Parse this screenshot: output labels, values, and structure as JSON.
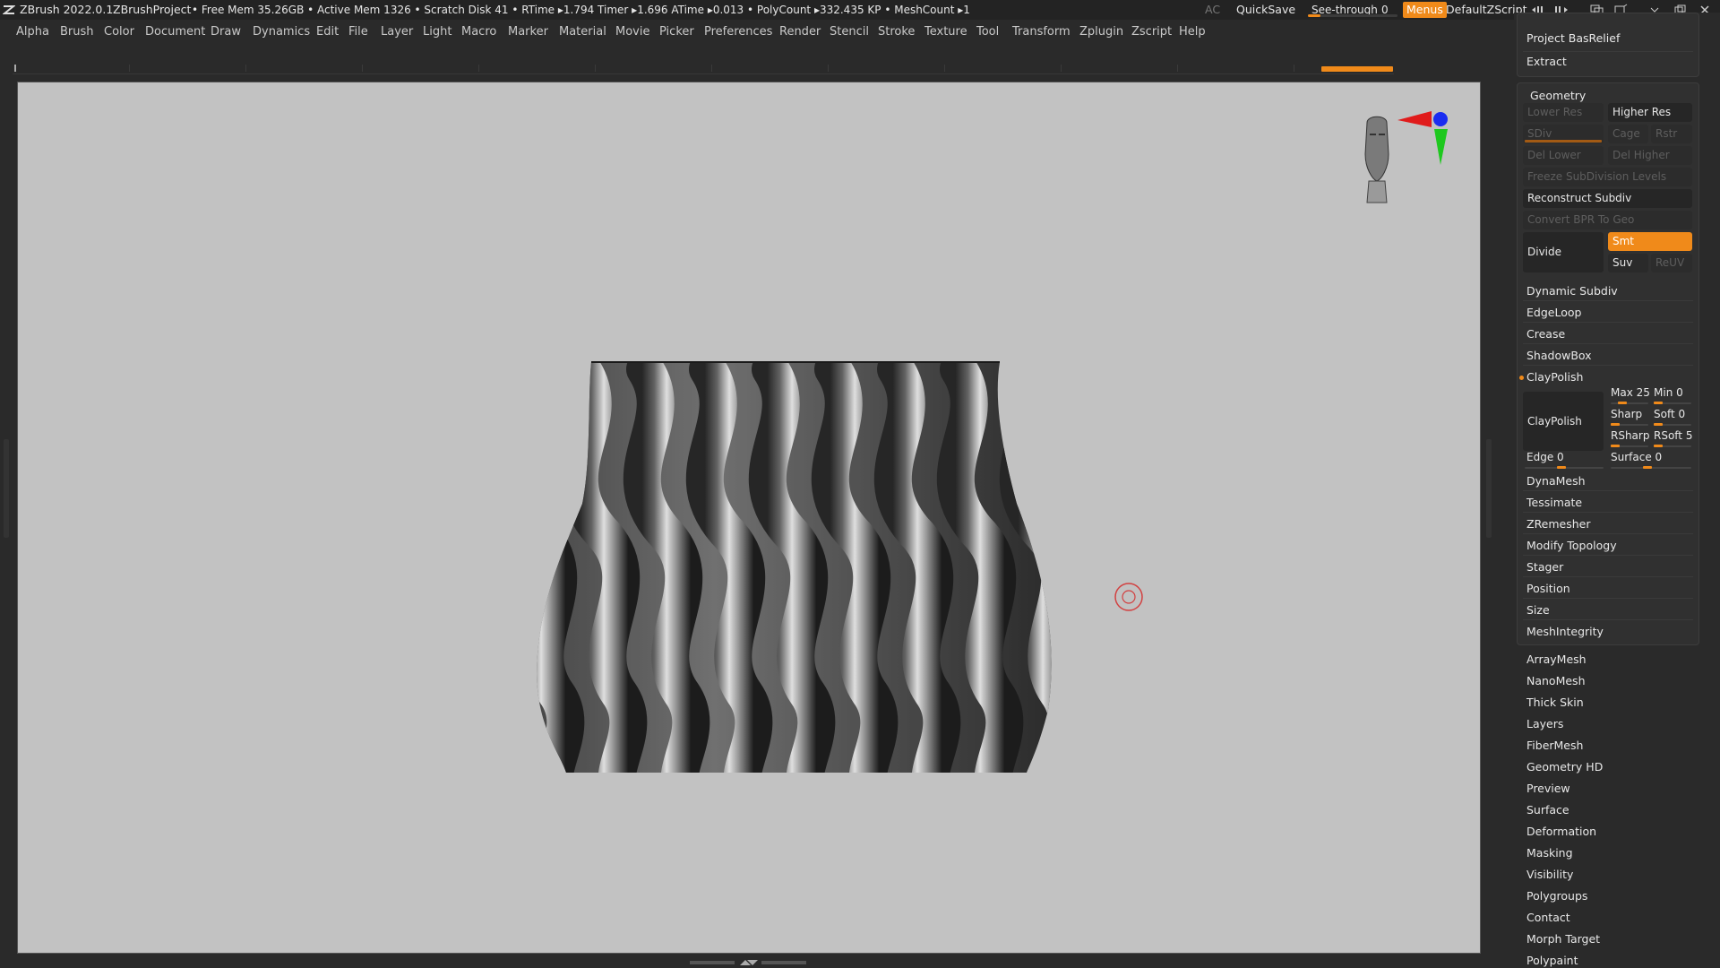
{
  "titlebar": {
    "app": "ZBrush 2022.0.1",
    "project": "ZBrushProject",
    "stats": "• Free Mem 35.26GB • Active Mem 1326 • Scratch Disk 41 •  RTime ▸1.794 Timer ▸1.696 ATime ▸0.013 • PolyCount ▸332.435 KP  • MeshCount ▸1",
    "ac": "AC",
    "quicksave": "QuickSave",
    "seethrough_label": "See-through",
    "seethrough_value": "0",
    "menus": "Menus",
    "script": "DefaultZScript"
  },
  "menubar": {
    "items": [
      "Alpha",
      "Brush",
      "Color",
      "Document",
      "Draw",
      "Dynamics",
      "Edit",
      "File",
      "Layer",
      "Light",
      "Macro",
      "Marker",
      "Material",
      "Movie",
      "Picker",
      "Preferences",
      "Render",
      "Stencil",
      "Stroke",
      "Texture",
      "Tool",
      "Transform",
      "Zplugin",
      "Zscript",
      "Help"
    ]
  },
  "panel": {
    "top_items": [
      "Project BasRelief",
      "Extract"
    ],
    "geometry": {
      "title": "Geometry",
      "lower_res": "Lower Res",
      "higher_res": "Higher Res",
      "sdiv": "SDiv",
      "cage": "Cage",
      "rstr": "Rstr",
      "del_lower": "Del Lower",
      "del_higher": "Del Higher",
      "freeze": "Freeze SubDivision Levels",
      "reconstruct": "Reconstruct Subdiv",
      "convert_bpr": "Convert BPR To Geo",
      "divide": "Divide",
      "smt": "Smt",
      "suv": "Suv",
      "reuv": "ReUV",
      "dynamic_subdiv": "Dynamic Subdiv",
      "edgeloop": "EdgeLoop",
      "crease": "Crease",
      "shadowbox": "ShadowBox",
      "claypolish_header": "ClayPolish",
      "claypolish_btn": "ClayPolish",
      "max": "Max 25",
      "min": "Min 0",
      "sharp": "Sharp",
      "soft": "Soft 0",
      "rsharp": "RSharp",
      "rsoft": "RSoft 5",
      "edge": "Edge 0",
      "surface": "Surface 0",
      "more": [
        "DynaMesh",
        "Tessimate",
        "ZRemesher",
        "Modify Topology",
        "Stager",
        "Position",
        "Size",
        "MeshIntegrity"
      ]
    },
    "subpalettes": [
      "ArrayMesh",
      "NanoMesh",
      "Thick Skin",
      "Layers",
      "FiberMesh",
      "Geometry HD",
      "Preview",
      "Surface",
      "Deformation",
      "Masking",
      "Visibility",
      "Polygroups",
      "Contact",
      "Morph Target",
      "Polypaint"
    ]
  },
  "colors": {
    "accent": "#f08a1a",
    "viewport_bg": "#c2c2c2",
    "panel_bg": "#2a2a2a"
  }
}
